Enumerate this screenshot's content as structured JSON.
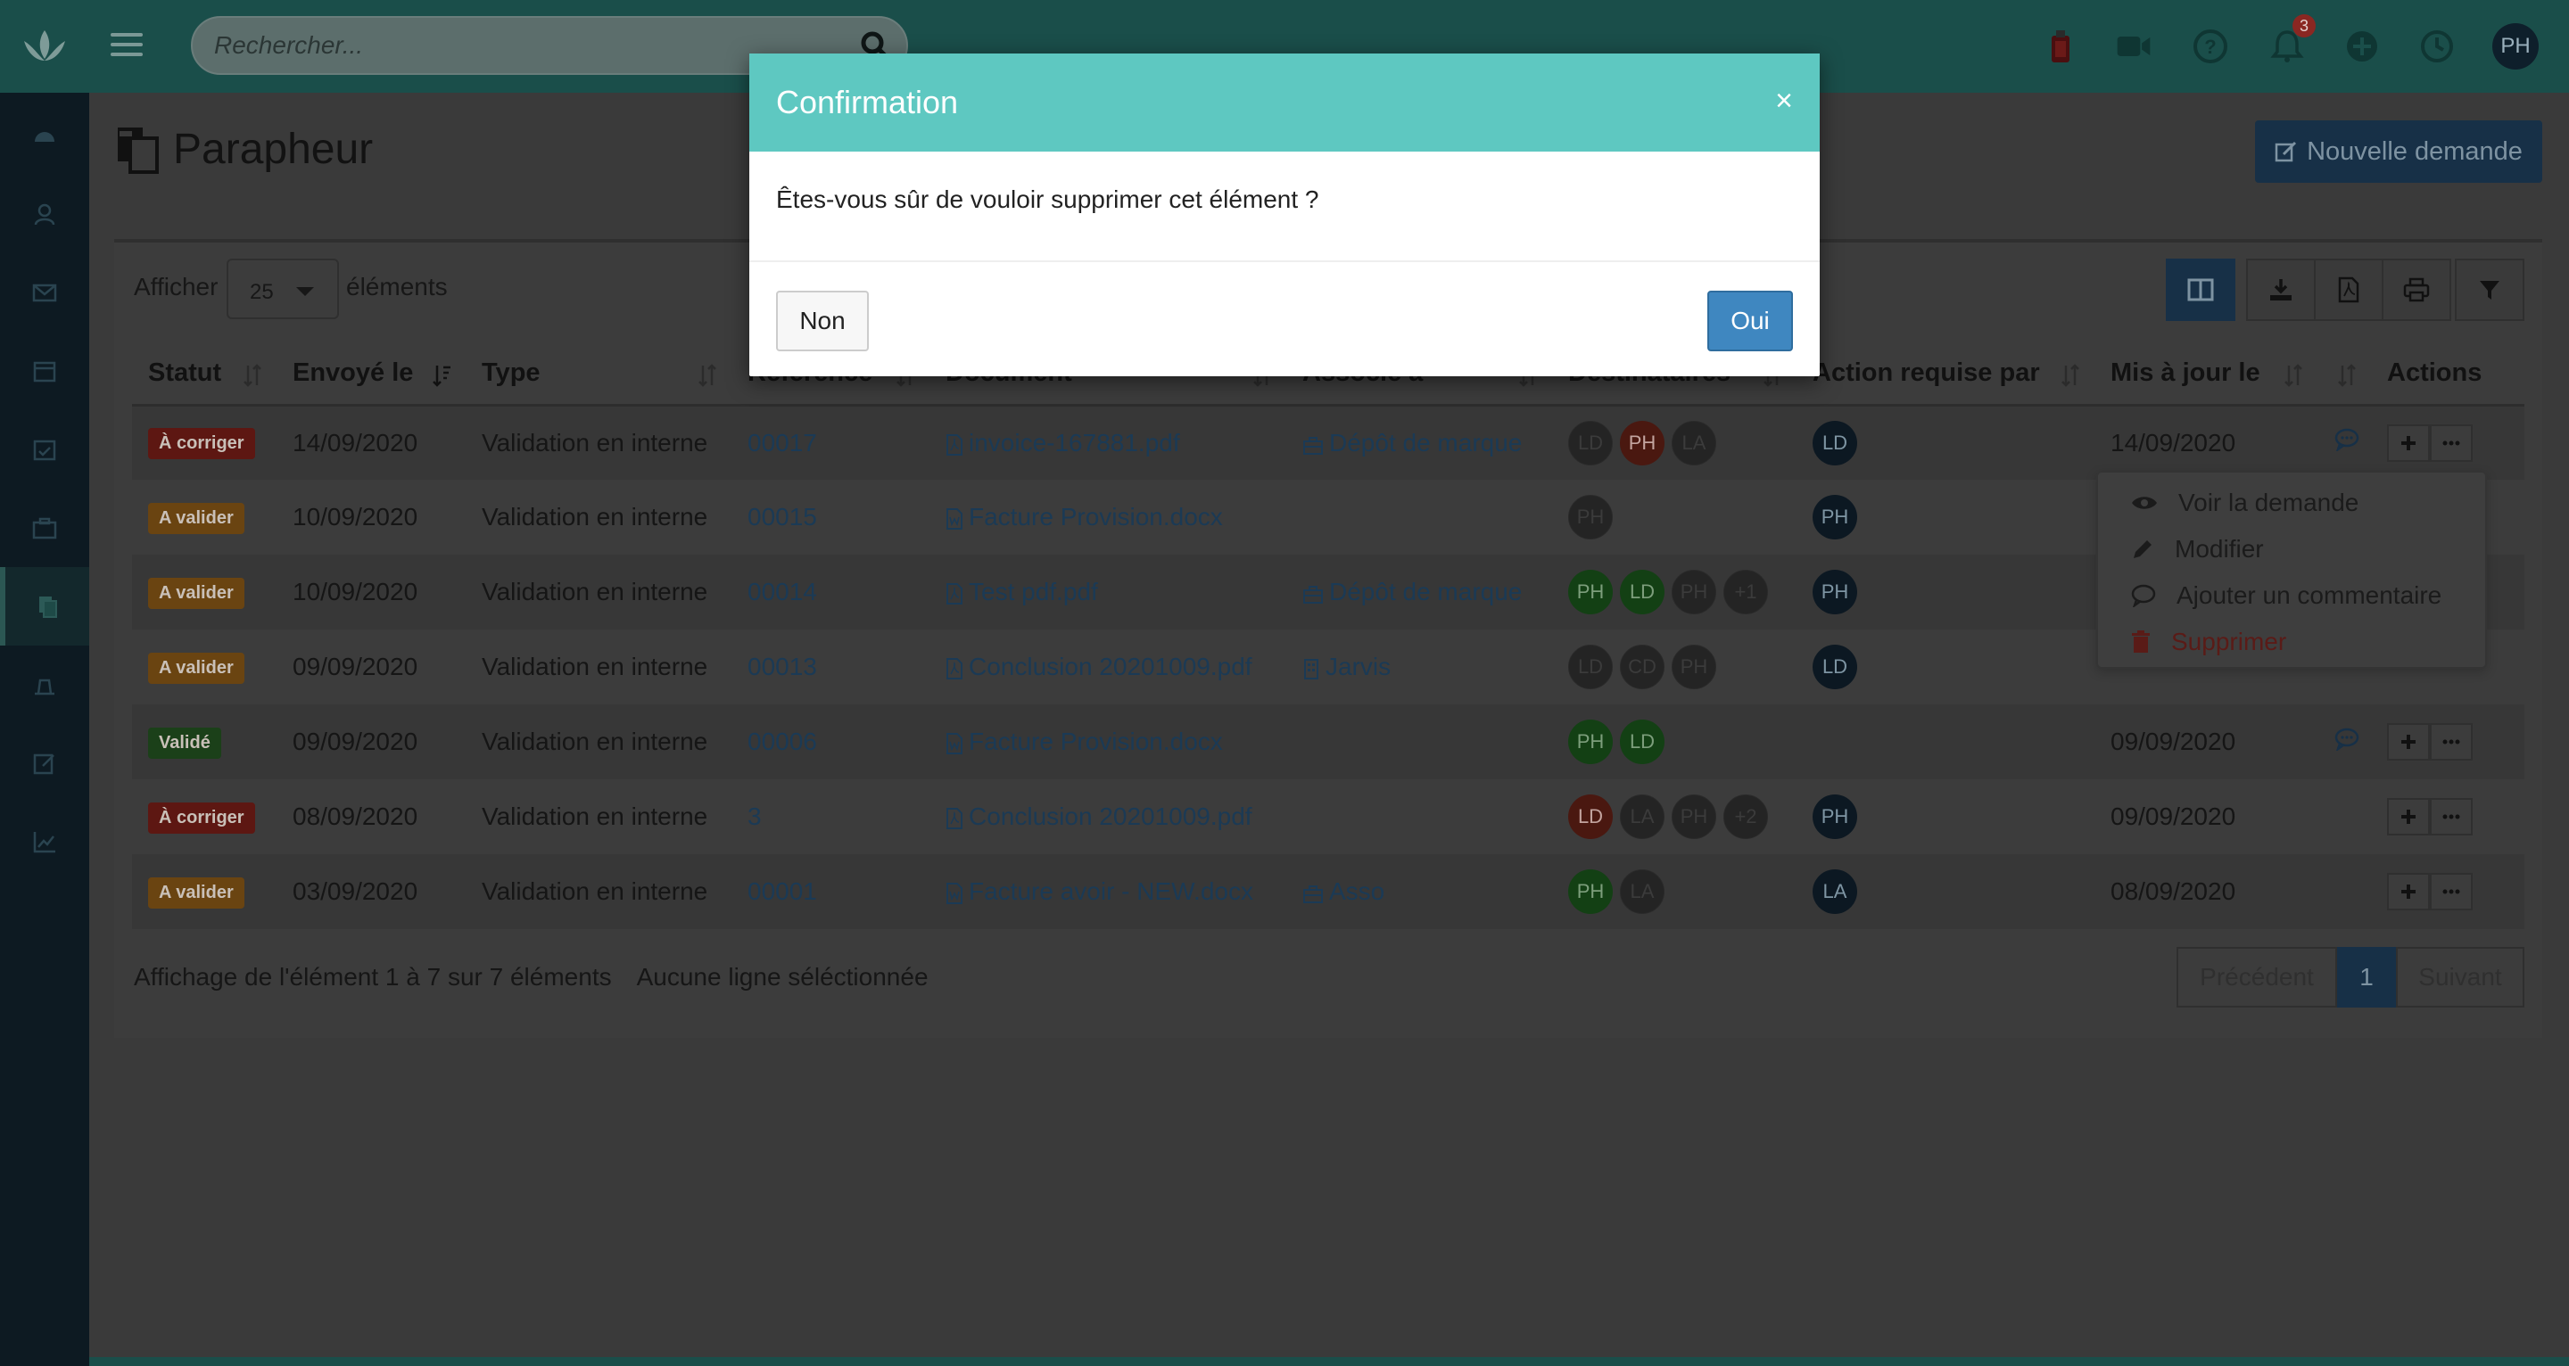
{
  "search": {
    "placeholder": "Rechercher..."
  },
  "notifications": {
    "count": "3"
  },
  "user": {
    "initials": "PH"
  },
  "page": {
    "title": "Parapheur",
    "new_button": "Nouvelle demande"
  },
  "length_menu": {
    "prefix": "Afficher",
    "value": "25",
    "suffix": "éléments"
  },
  "table": {
    "headers": [
      "Statut",
      "Envoyé le",
      "Type",
      "Référence",
      "Document",
      "Associé à",
      "Destinataires",
      "Action requise par",
      "Mis à jour le",
      "",
      "Actions"
    ],
    "rows": [
      {
        "status": "À corriger",
        "sent": "14/09/2020",
        "type": "Validation en interne",
        "ref": "00017",
        "doc": "invoice-167881.pdf",
        "assoc": "Dépôt de marque",
        "dest": [
          "LD",
          "PH",
          "LA"
        ],
        "action_by": "LD",
        "updated": "14/09/2020"
      },
      {
        "status": "A valider",
        "sent": "10/09/2020",
        "type": "Validation en interne",
        "ref": "00015",
        "doc": "Facture Provision.docx",
        "assoc": "",
        "dest": [
          "PH"
        ],
        "action_by": "PH",
        "updated": ""
      },
      {
        "status": "A valider",
        "sent": "10/09/2020",
        "type": "Validation en interne",
        "ref": "00014",
        "doc": "Test pdf.pdf",
        "assoc": "Dépôt de marque",
        "dest": [
          "PH",
          "LD",
          "PH",
          "+1"
        ],
        "action_by": "PH",
        "updated": ""
      },
      {
        "status": "A valider",
        "sent": "09/09/2020",
        "type": "Validation en interne",
        "ref": "00013",
        "doc": "Conclusion 20201009.pdf",
        "assoc": "Jarvis",
        "dest": [
          "LD",
          "CD",
          "PH"
        ],
        "action_by": "LD",
        "updated": ""
      },
      {
        "status": "Validé",
        "sent": "09/09/2020",
        "type": "Validation en interne",
        "ref": "00006",
        "doc": "Facture Provision.docx",
        "assoc": "",
        "dest": [
          "PH",
          "LD"
        ],
        "action_by": "",
        "updated": "09/09/2020"
      },
      {
        "status": "À corriger",
        "sent": "08/09/2020",
        "type": "Validation en interne",
        "ref": "3",
        "doc": "Conclusion 20201009.pdf",
        "assoc": "",
        "dest": [
          "LD",
          "LA",
          "PH",
          "+2"
        ],
        "action_by": "PH",
        "updated": "09/09/2020"
      },
      {
        "status": "A valider",
        "sent": "03/09/2020",
        "type": "Validation en interne",
        "ref": "00001",
        "doc": "Facture avoir - NEW.docx",
        "assoc": "Asso",
        "dest": [
          "PH",
          "LA"
        ],
        "action_by": "LA",
        "updated": "08/09/2020"
      }
    ]
  },
  "dropdown": {
    "view": "Voir la demande",
    "edit": "Modifier",
    "comment": "Ajouter un commentaire",
    "delete": "Supprimer"
  },
  "footer": {
    "info": "Affichage de l'élément 1 à 7 sur 7 éléments",
    "selection": "Aucune ligne séléctionnée"
  },
  "pagination": {
    "prev": "Précédent",
    "page": "1",
    "next": "Suivant"
  },
  "modal": {
    "title": "Confirmation",
    "close": "×",
    "message": "Êtes-vous sûr de vouloir supprimer cet élément ?",
    "cancel": "Non",
    "confirm": "Oui"
  },
  "colors": {
    "brand": "#5ec8c1",
    "primary": "#3f87c0",
    "sidebar": "#0d1a22"
  }
}
